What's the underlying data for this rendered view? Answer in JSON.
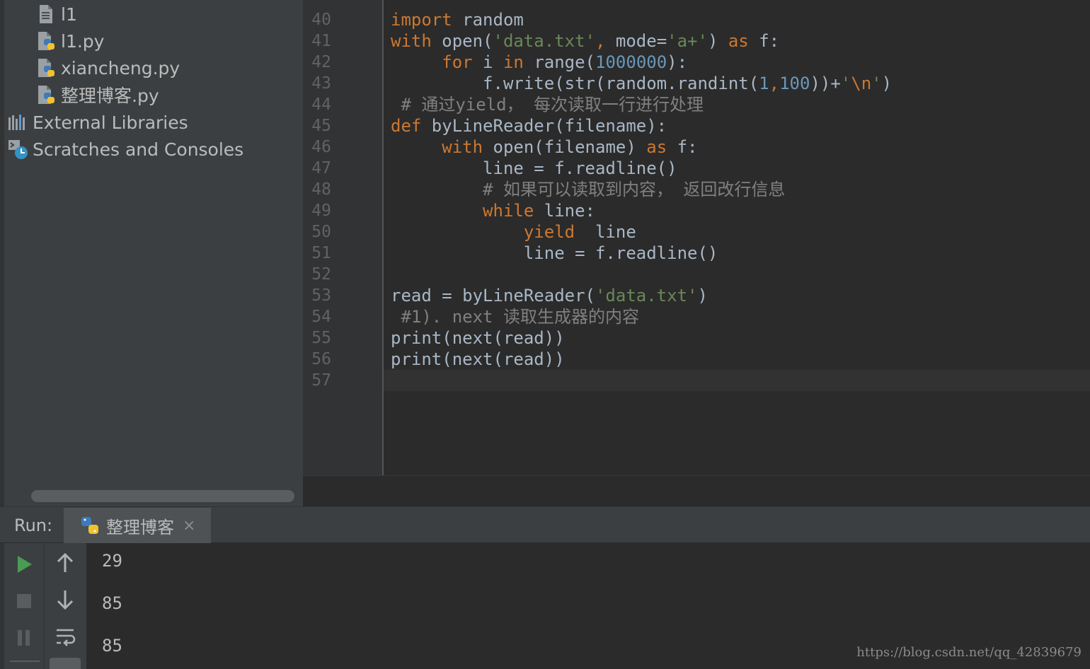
{
  "project_tree": {
    "items": [
      {
        "label": "l1",
        "icon": "text-file-icon"
      },
      {
        "label": "l1.py",
        "icon": "python-file-icon"
      },
      {
        "label": "xiancheng.py",
        "icon": "python-file-icon"
      },
      {
        "label": "整理博客.py",
        "icon": "python-file-icon"
      },
      {
        "label": "External Libraries",
        "icon": "libraries-icon"
      },
      {
        "label": "Scratches and Consoles",
        "icon": "scratches-icon"
      }
    ]
  },
  "editor": {
    "line_numbers": [
      "40",
      "41",
      "42",
      "43",
      "44",
      "45",
      "46",
      "47",
      "48",
      "49",
      "50",
      "51",
      "52",
      "53",
      "54",
      "55",
      "56",
      "57"
    ],
    "lines": [
      [
        {
          "t": "kw",
          "v": "import "
        },
        {
          "t": "idf",
          "v": "random"
        }
      ],
      [
        {
          "t": "kw",
          "v": "with "
        },
        {
          "t": "idf",
          "v": "open("
        },
        {
          "t": "str",
          "v": "'data.txt'"
        },
        {
          "t": "kw",
          "v": ", "
        },
        {
          "t": "idf",
          "v": "mode="
        },
        {
          "t": "str",
          "v": "'a+'"
        },
        {
          "t": "idf",
          "v": ") "
        },
        {
          "t": "kw",
          "v": "as "
        },
        {
          "t": "idf",
          "v": "f:"
        }
      ],
      [
        {
          "t": "kw",
          "v": "     for "
        },
        {
          "t": "idf",
          "v": "i "
        },
        {
          "t": "kw",
          "v": "in "
        },
        {
          "t": "idf",
          "v": "range("
        },
        {
          "t": "num",
          "v": "1000000"
        },
        {
          "t": "idf",
          "v": "):"
        }
      ],
      [
        {
          "t": "idf",
          "v": "         f.write(str(random.randint("
        },
        {
          "t": "num",
          "v": "1"
        },
        {
          "t": "kw",
          "v": ","
        },
        {
          "t": "num",
          "v": "100"
        },
        {
          "t": "idf",
          "v": "))+"
        },
        {
          "t": "str",
          "v": "'"
        },
        {
          "t": "kw",
          "v": "\\n"
        },
        {
          "t": "str",
          "v": "'"
        },
        {
          "t": "idf",
          "v": ")"
        }
      ],
      [
        {
          "t": "cm",
          "v": " # 通过yield， 每次读取一行进行处理"
        }
      ],
      [
        {
          "t": "kw",
          "v": "def "
        },
        {
          "t": "idf",
          "v": "byLineReader(filename):"
        }
      ],
      [
        {
          "t": "kw",
          "v": "     with "
        },
        {
          "t": "idf",
          "v": "open(filename) "
        },
        {
          "t": "kw",
          "v": "as "
        },
        {
          "t": "idf",
          "v": "f:"
        }
      ],
      [
        {
          "t": "idf",
          "v": "         line = f.readline()"
        }
      ],
      [
        {
          "t": "cm",
          "v": "         # 如果可以读取到内容， 返回改行信息"
        }
      ],
      [
        {
          "t": "kw",
          "v": "         while "
        },
        {
          "t": "idf",
          "v": "line:"
        }
      ],
      [
        {
          "t": "kw",
          "v": "             yield  "
        },
        {
          "t": "idf",
          "v": "line"
        }
      ],
      [
        {
          "t": "idf",
          "v": "             line = f.readline()"
        }
      ],
      [],
      [
        {
          "t": "idf",
          "v": "read = byLineReader("
        },
        {
          "t": "str",
          "v": "'data.txt'"
        },
        {
          "t": "idf",
          "v": ")"
        }
      ],
      [
        {
          "t": "cm",
          "v": " #1). next 读取生成器的内容"
        }
      ],
      [
        {
          "t": "idf",
          "v": "print(next(read))"
        }
      ],
      [
        {
          "t": "idf",
          "v": "print(next(read))"
        }
      ],
      []
    ]
  },
  "run_panel": {
    "label": "Run:",
    "tab_label": "整理博客",
    "tab_close": "×",
    "output": [
      "29",
      "85",
      "85"
    ]
  },
  "watermark": "https://blog.csdn.net/qq_42839679",
  "colors": {
    "keyword": "#cc7832",
    "string": "#6a8759",
    "number": "#6897bb",
    "comment": "#808080",
    "identifier": "#a9b7c6",
    "run_green": "#499c54"
  }
}
